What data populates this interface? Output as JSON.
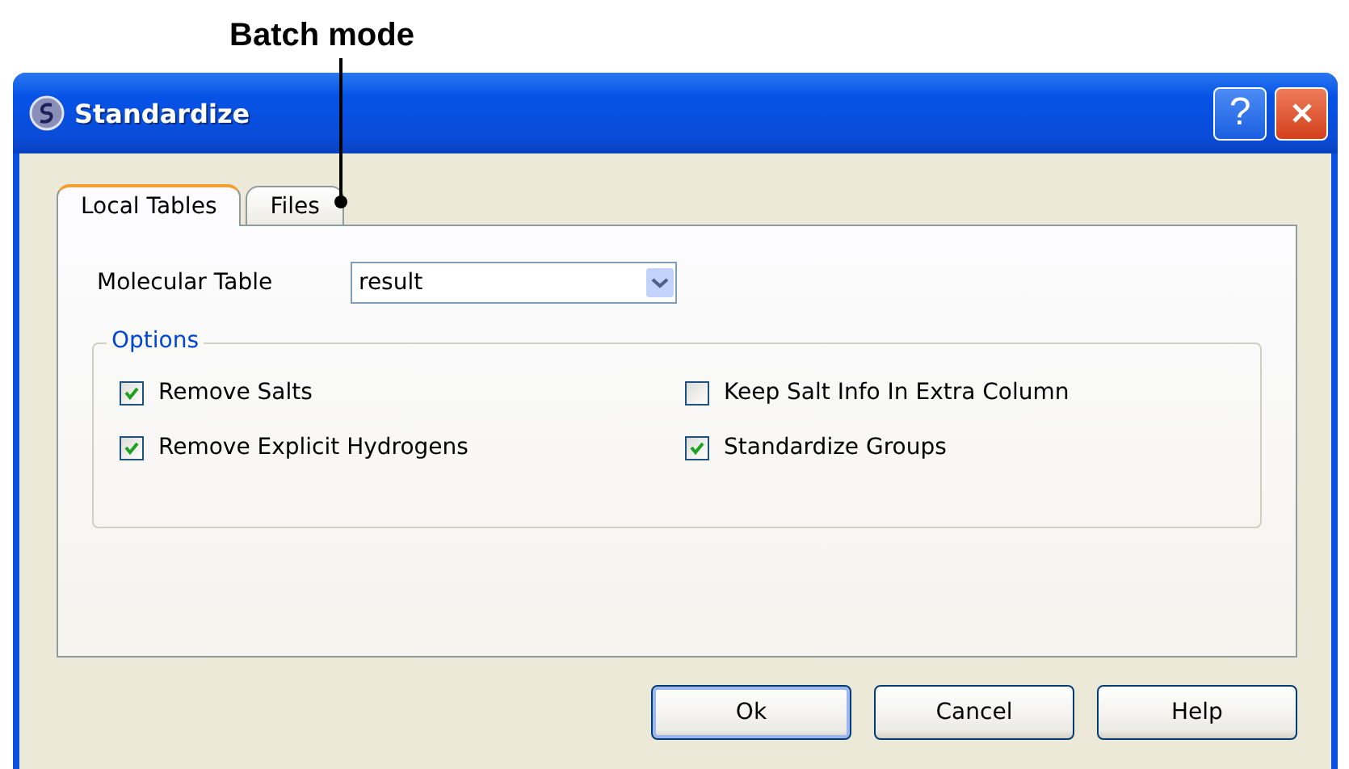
{
  "annotation": {
    "text": "Batch mode"
  },
  "window": {
    "title": "Standardize",
    "help_button": "?"
  },
  "tabs": [
    {
      "label": "Local Tables",
      "selected": true
    },
    {
      "label": "Files",
      "selected": false
    }
  ],
  "molecular_table": {
    "label": "Molecular Table",
    "value": "result"
  },
  "options": {
    "title": "Options",
    "items": [
      {
        "label": "Remove Salts",
        "checked": true
      },
      {
        "label": "Keep Salt Info In Extra Column",
        "checked": false
      },
      {
        "label": "Remove Explicit Hydrogens",
        "checked": true
      },
      {
        "label": "Standardize Groups",
        "checked": true
      }
    ]
  },
  "buttons": [
    {
      "label": "Ok",
      "default": true
    },
    {
      "label": "Cancel",
      "default": false
    },
    {
      "label": "Help",
      "default": false
    }
  ]
}
